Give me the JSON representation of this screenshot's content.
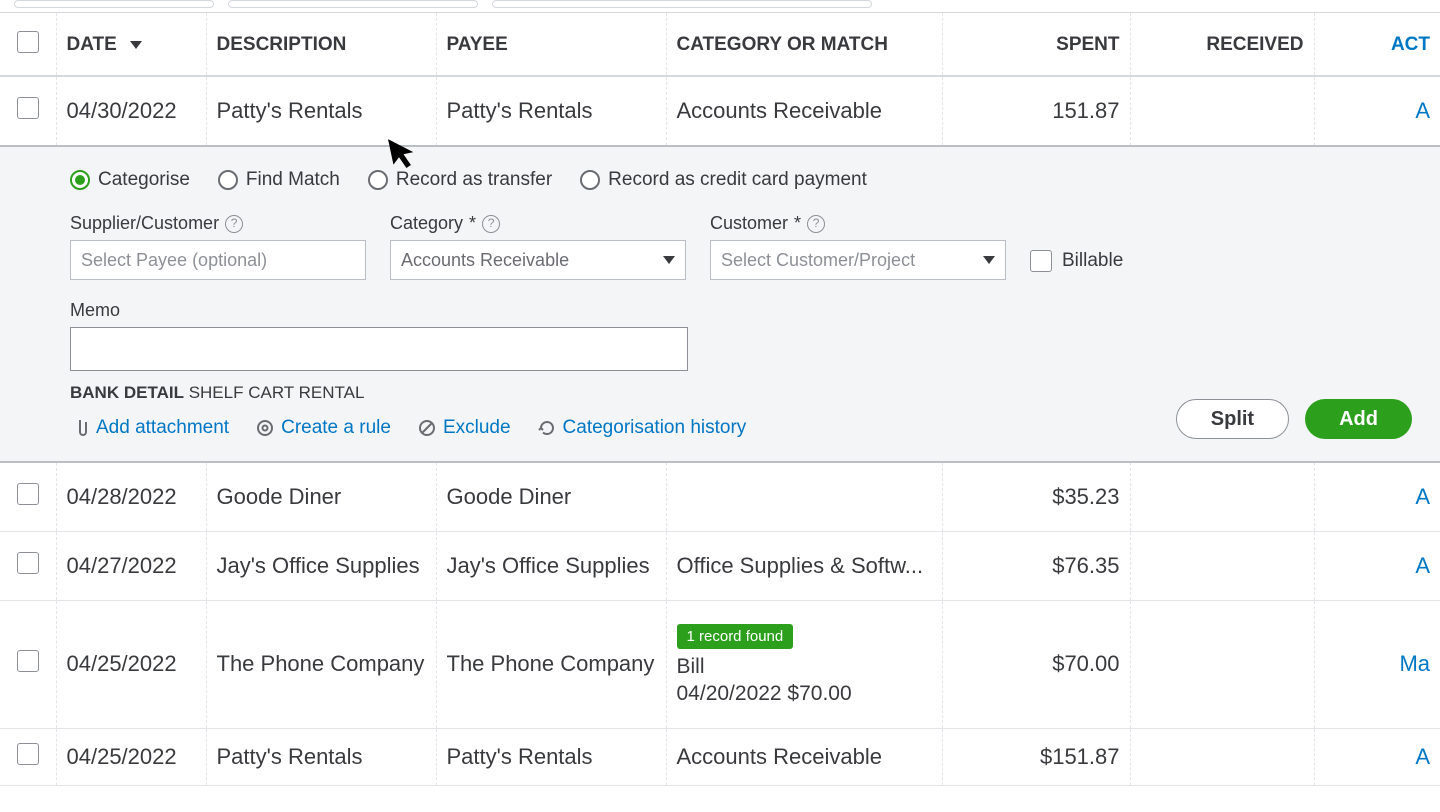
{
  "columns": {
    "date": "DATE",
    "description": "DESCRIPTION",
    "payee": "PAYEE",
    "category": "CATEGORY OR MATCH",
    "spent": "SPENT",
    "received": "RECEIVED",
    "action": "ACT"
  },
  "rows": [
    {
      "date": "04/30/2022",
      "desc": "Patty's Rentals",
      "payee": "Patty's Rentals",
      "category": "Accounts Receivable",
      "spent": "151.87",
      "received": "",
      "action": "A"
    },
    {
      "date": "04/28/2022",
      "desc": "Goode Diner",
      "payee": "Goode Diner",
      "category": "",
      "spent": "$35.23",
      "received": "",
      "action": "A"
    },
    {
      "date": "04/27/2022",
      "desc": "Jay's Office Supplies",
      "payee": "Jay's Office Supplies",
      "category": "Office Supplies & Softw...",
      "spent": "$76.35",
      "received": "",
      "action": "A"
    },
    {
      "date": "04/25/2022",
      "desc": "The Phone Company",
      "payee": "The Phone Company",
      "category": "",
      "spent": "$70.00",
      "received": "",
      "action": "Ma"
    },
    {
      "date": "04/25/2022",
      "desc": "Patty's Rentals",
      "payee": "Patty's Rentals",
      "category": "Accounts Receivable",
      "spent": "$151.87",
      "received": "",
      "action": "A"
    }
  ],
  "match": {
    "badge": "1 record found",
    "line1": "Bill",
    "line2": "04/20/2022   $70.00"
  },
  "panel": {
    "radios": {
      "categorise": "Categorise",
      "find_match": "Find Match",
      "record_transfer": "Record as transfer",
      "record_cc": "Record as credit card payment"
    },
    "supplier_label": "Supplier/Customer",
    "supplier_placeholder": "Select Payee (optional)",
    "category_label": "Category",
    "category_value": "Accounts Receivable",
    "customer_label": "Customer",
    "customer_placeholder": "Select Customer/Project",
    "billable": "Billable",
    "memo_label": "Memo",
    "bank_detail_label": "BANK DETAIL",
    "bank_detail_value": "SHELF CART RENTAL",
    "links": {
      "add_attachment": "Add attachment",
      "create_rule": "Create a rule",
      "exclude": "Exclude",
      "history": "Categorisation history"
    },
    "split": "Split",
    "add": "Add",
    "required_mark": "*"
  }
}
